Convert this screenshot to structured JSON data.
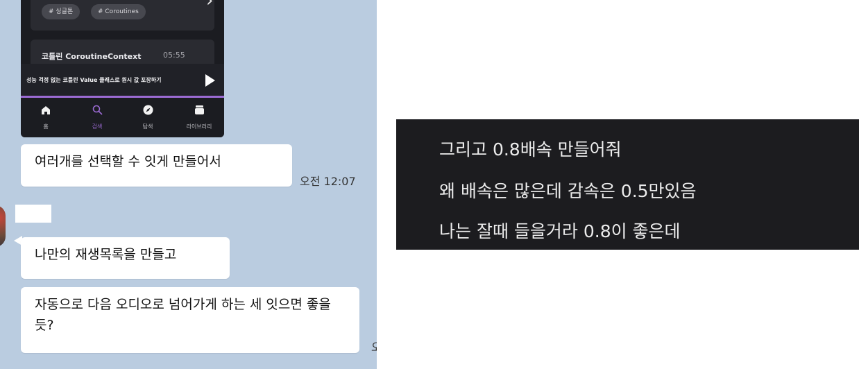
{
  "app": {
    "tags": [
      "# 싱글톤",
      "# Coroutines"
    ],
    "episode": {
      "title": "코틀린 CoroutineContext",
      "time": "05:55"
    },
    "player": {
      "title": "성능 걱정 없는 코틀린 Value 클래스로 원시 값 포장하기"
    },
    "tabs": [
      {
        "label": "홈",
        "icon": "home-icon",
        "active": false
      },
      {
        "label": "검색",
        "icon": "search-icon",
        "active": true
      },
      {
        "label": "탐색",
        "icon": "compass-icon",
        "active": false
      },
      {
        "label": "라이브러리",
        "icon": "library-icon",
        "active": false
      }
    ],
    "accent": "#9c6bd4"
  },
  "messages": [
    {
      "text": "여러개를 선택할 수 잇게 만들어서",
      "time": "오전 12:07"
    },
    {
      "text": "나만의 재생목록을 만들고"
    },
    {
      "text": "자동으로 다음 오디오로 넘어가게 하는 세 잇으면 좋을듯?",
      "time": "오"
    }
  ],
  "notes": [
    "그리고 0.8배속 만들어줘",
    "왜 배속은 많은데 감속은 0.5만있음",
    "나는 잘때 들을거라 0.8이 좋은데"
  ]
}
